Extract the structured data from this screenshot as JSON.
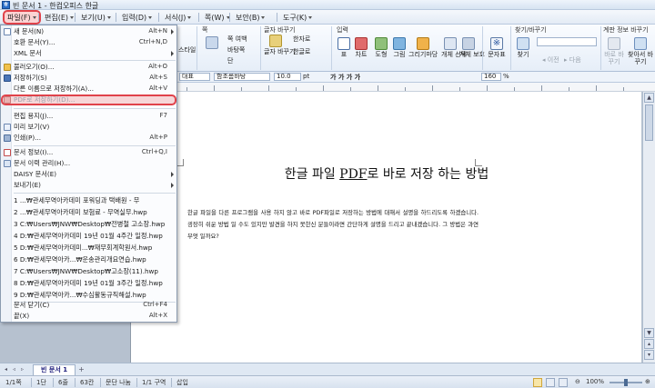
{
  "window": {
    "title": "빈 문서 1 - 한컴오피스 한글"
  },
  "menubar": {
    "items": [
      "파일(F)",
      "편집(E)",
      "보기(U)",
      "입력(D)",
      "서식(J)",
      "쪽(W)",
      "보안(B)",
      "도구(K)"
    ]
  },
  "ribbon": {
    "style_label": "스타일",
    "page_label": "쪽",
    "multi_col_label": "다단 설정",
    "columns_label": "쪽 여백",
    "bg_label": "바탕쪽",
    "split_label": "단",
    "glyph_convert_group": "글자 바꾸기",
    "hanja_label": "한자로",
    "char_label": "글자 바꾸기",
    "hangul_label": "한글로",
    "input_group": "입력",
    "table_label": "표",
    "chart_label": "차트",
    "shape_label": "도형",
    "picture_label": "그림",
    "drawing_label": "그리기마당",
    "object_select_label": "개체 선택",
    "char_share_label": "개체 보호",
    "char_map_label": "문자표",
    "find_group": "찾기/바꾸기",
    "find_label": "찾기",
    "prev_label": "이전",
    "next_label": "다음",
    "replace_group": "계판 정보 바꾸기",
    "rereplace_label": "바로 바꾸기",
    "find_replace_label": "찾아서 바꾸기"
  },
  "formatbar": {
    "style_value": "대표",
    "font_value": "함초롬바탕",
    "size_value": "10.0",
    "size_unit": "pt",
    "bold_group": "가 가 가 가",
    "zoom_value": "160",
    "zoom_unit": "%"
  },
  "filemenu": {
    "items": [
      {
        "label": "새 문서(N)",
        "shortcut": "Alt+N",
        "arrow": true
      },
      {
        "label": "호환 문서(Y)...",
        "shortcut": "Ctrl+N,D",
        "arrow": false
      },
      {
        "label": "XML 문서",
        "shortcut": "",
        "arrow": true
      },
      {
        "label": "불러오기(O)...",
        "shortcut": "Alt+O",
        "arrow": false
      },
      {
        "label": "저장하기(S)",
        "shortcut": "Alt+S",
        "arrow": false
      },
      {
        "label": "다른 이름으로 저장하기(A)...",
        "shortcut": "Alt+V",
        "arrow": false
      },
      {
        "label": "PDF로 저장하기(D)...",
        "shortcut": "",
        "arrow": false
      },
      {
        "label": "편집 용지(J)...",
        "shortcut": "F7",
        "arrow": false
      },
      {
        "label": "미리 보기(V)",
        "shortcut": "",
        "arrow": false
      },
      {
        "label": "인쇄(P)...",
        "shortcut": "Alt+P",
        "arrow": false
      },
      {
        "label": "문서 정보(I)...",
        "shortcut": "Ctrl+Q,I",
        "arrow": false
      },
      {
        "label": "문서 이력 관리(H)...",
        "shortcut": "",
        "arrow": false
      },
      {
        "label": "DAISY 문서(E)",
        "shortcut": "",
        "arrow": true
      },
      {
        "label": "보내기(E)",
        "shortcut": "",
        "arrow": true
      },
      {
        "label": "1 ...₩관세무역아카데미 포워딩과 택배원 - 무",
        "shortcut": "",
        "arrow": false
      },
      {
        "label": "2 ...₩관세무역아카데미 보험료 - 무역실무.hwp",
        "shortcut": "",
        "arrow": false
      },
      {
        "label": "3 C:₩Users₩JNW₩Desktop₩전병철 고소장.hwp",
        "shortcut": "",
        "arrow": false
      },
      {
        "label": "4 D:₩관세무역아카데미 19년 01월 4주간 일정.hwp",
        "shortcut": "",
        "arrow": false
      },
      {
        "label": "5 D:₩관세무역아카데미...₩재무회계학원서.hwp",
        "shortcut": "",
        "arrow": false
      },
      {
        "label": "6 D:₩관세무역아카...₩운송관리개요연습.hwp",
        "shortcut": "",
        "arrow": false
      },
      {
        "label": "7 C:₩Users₩JNW₩Desktop₩고소장(11).hwp",
        "shortcut": "",
        "arrow": false
      },
      {
        "label": "8 D:₩관세무역아카데미 19년 01월 3주간 일정.hwp",
        "shortcut": "",
        "arrow": false
      },
      {
        "label": "9 D:₩관세무역아카...₩수심활동규직해설.hwp",
        "shortcut": "",
        "arrow": false
      },
      {
        "label": "문서 닫기(C)",
        "shortcut": "Ctrl+F4",
        "arrow": false
      },
      {
        "label": "끝(X)",
        "shortcut": "Alt+X",
        "arrow": false
      }
    ]
  },
  "document": {
    "title_pre": "한글 파일 ",
    "title_pdf": "PDF",
    "title_post": "로 바로 저장 하는 방법",
    "body": "한글 파일을 다른 프로그램을 사용 하지 않고 바로 PDF파일로 저장하는 방법에 대해서 설명을 하드리도록 하겠습니다. 굉장히 쉬운 방법 일 수도 있지만 발견을 하지 못한신 분들이라면 간단하게 설명을 드리고 끝내겠습니다. 그 방법은 과연 무엇 일까요?"
  },
  "tabbar": {
    "doc_tab": "빈 문서 1"
  },
  "statusbar": {
    "page": "1/1쪽",
    "section": "1단",
    "line": "6줄",
    "col": "63칸",
    "para_break": "문단 나눔",
    "area": "1/1 구역",
    "insert": "삽입",
    "zoom": "100%"
  }
}
